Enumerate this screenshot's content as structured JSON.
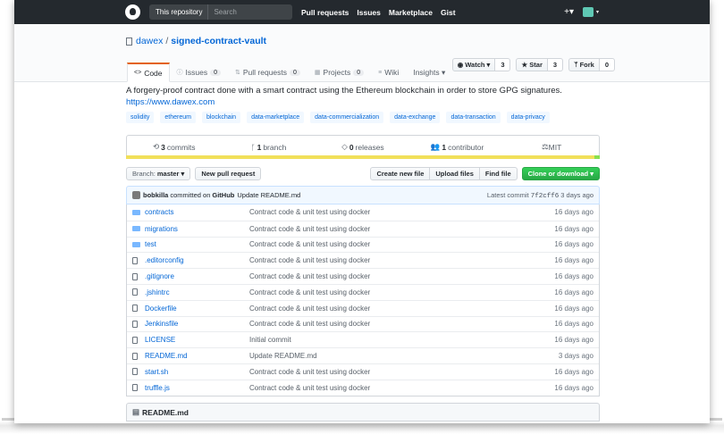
{
  "header": {
    "search_scope": "This repository",
    "search_placeholder": "Search",
    "nav": [
      "Pull requests",
      "Issues",
      "Marketplace",
      "Gist"
    ],
    "plus": "+▾"
  },
  "repo": {
    "owner": "dawex",
    "separator": "/",
    "name": "signed-contract-vault",
    "watch_label": "Watch ▾",
    "watch_count": "3",
    "star_label": "★ Star",
    "star_count": "3",
    "fork_label": "Fork",
    "fork_count": "0",
    "tabs": [
      {
        "icon": "<>",
        "label": "Code",
        "count": ""
      },
      {
        "icon": "ⓘ",
        "label": "Issues",
        "count": "0"
      },
      {
        "icon": "⇅",
        "label": "Pull requests",
        "count": "0"
      },
      {
        "icon": "▦",
        "label": "Projects",
        "count": "0"
      },
      {
        "icon": "≡",
        "label": "Wiki",
        "count": ""
      },
      {
        "icon": "",
        "label": "Insights ▾",
        "count": ""
      }
    ],
    "description": "A forgery-proof contract done with a smart contract using the Ethereum blockchain in order to store GPG signatures.",
    "homepage": "https://www.dawex.com",
    "topics": [
      "solidity",
      "ethereum",
      "blockchain",
      "data-marketplace",
      "data-commercialization",
      "data-exchange",
      "data-transaction",
      "data-privacy"
    ]
  },
  "summary": {
    "commits_count": "3",
    "commits_label": "commits",
    "branch_count": "1",
    "branch_label": "branch",
    "releases_count": "0",
    "releases_label": "releases",
    "contributor_count": "1",
    "contributor_label": "contributor",
    "license": "MIT",
    "lang_colors": {
      "JavaScript": "#f1e05a",
      "Shell": "#89e051"
    }
  },
  "filenav": {
    "branch_prefix": "Branch:",
    "branch_name": "master ▾",
    "new_pr": "New pull request",
    "create_file": "Create new file",
    "upload_files": "Upload files",
    "find_file": "Find file",
    "clone": "Clone or download ▾"
  },
  "commit": {
    "author": "bobkilla",
    "committed_text": "committed on",
    "platform": "GitHub",
    "message": "Update README.md",
    "latest_label": "Latest commit",
    "sha": "7f2cff6",
    "age": "3 days ago"
  },
  "files": [
    {
      "type": "dir",
      "name": "contracts",
      "message": "Contract code & unit test using docker",
      "age": "16 days ago"
    },
    {
      "type": "dir",
      "name": "migrations",
      "message": "Contract code & unit test using docker",
      "age": "16 days ago"
    },
    {
      "type": "dir",
      "name": "test",
      "message": "Contract code & unit test using docker",
      "age": "16 days ago"
    },
    {
      "type": "file",
      "name": ".editorconfig",
      "message": "Contract code & unit test using docker",
      "age": "16 days ago"
    },
    {
      "type": "file",
      "name": ".gitignore",
      "message": "Contract code & unit test using docker",
      "age": "16 days ago"
    },
    {
      "type": "file",
      "name": ".jshintrc",
      "message": "Contract code & unit test using docker",
      "age": "16 days ago"
    },
    {
      "type": "file",
      "name": "Dockerfile",
      "message": "Contract code & unit test using docker",
      "age": "16 days ago"
    },
    {
      "type": "file",
      "name": "Jenkinsfile",
      "message": "Contract code & unit test using docker",
      "age": "16 days ago"
    },
    {
      "type": "file",
      "name": "LICENSE",
      "message": "Initial commit",
      "age": "16 days ago"
    },
    {
      "type": "file",
      "name": "README.md",
      "message": "Update README.md",
      "age": "3 days ago"
    },
    {
      "type": "file",
      "name": "start.sh",
      "message": "Contract code & unit test using docker",
      "age": "16 days ago"
    },
    {
      "type": "file",
      "name": "truffle.js",
      "message": "Contract code & unit test using docker",
      "age": "16 days ago"
    }
  ],
  "readme": {
    "title": "README.md"
  }
}
